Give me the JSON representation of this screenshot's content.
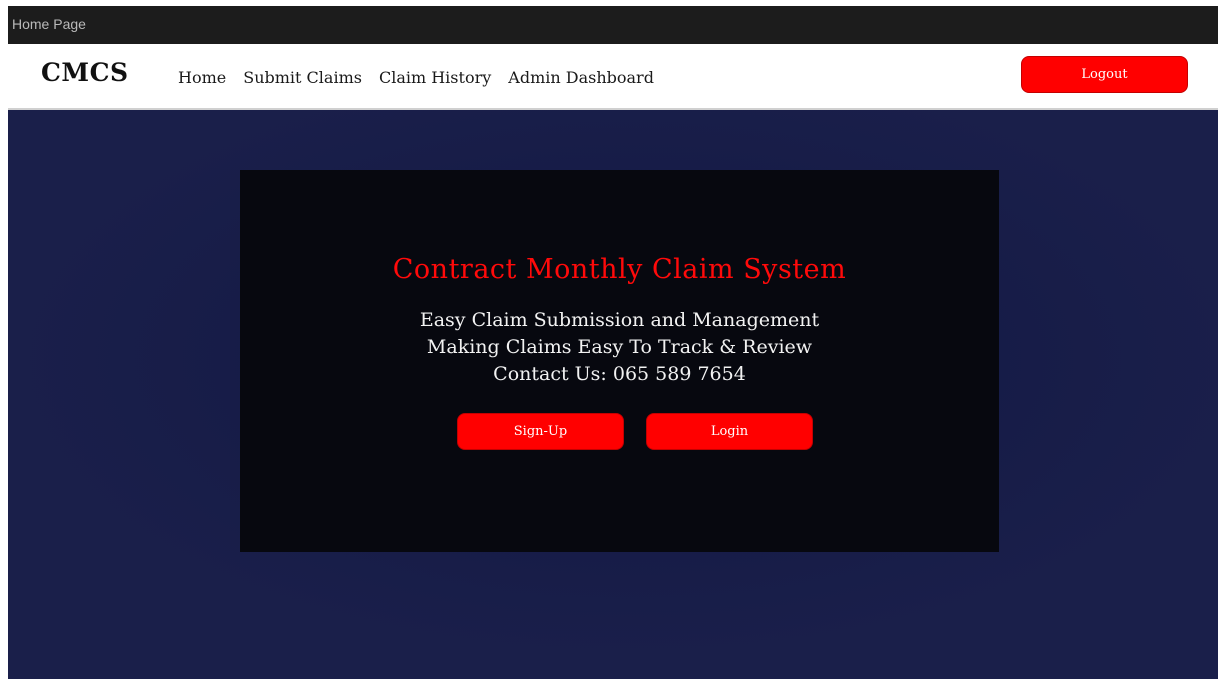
{
  "window": {
    "title": "Home Page"
  },
  "navbar": {
    "brand": "CMCS",
    "links": [
      {
        "label": "Home"
      },
      {
        "label": "Submit Claims"
      },
      {
        "label": "Claim History"
      },
      {
        "label": "Admin Dashboard"
      }
    ],
    "logout_label": "Logout"
  },
  "hero": {
    "title": "Contract Monthly Claim System",
    "lines": [
      "Easy Claim Submission and Management",
      "Making Claims Easy To Track & Review",
      "Contact Us:  065 589 7654"
    ],
    "signup_label": "Sign-Up",
    "login_label": "Login"
  },
  "colors": {
    "page_background": "#1a1f4a",
    "hero_background": "#07080f",
    "accent": "#ff0000",
    "title_bar": "#1c1c1c"
  }
}
